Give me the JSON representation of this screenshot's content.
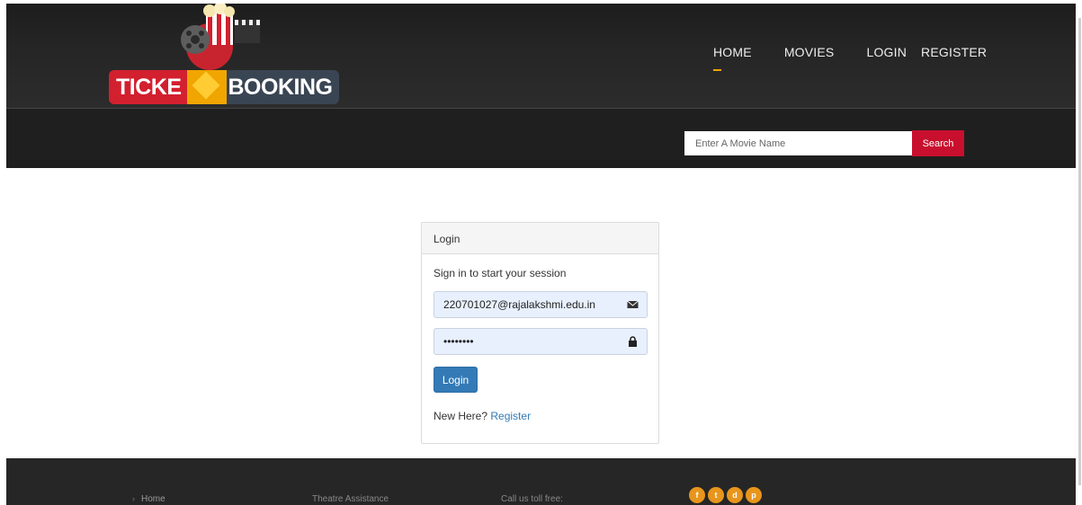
{
  "brand": {
    "logo_left": "TICKE",
    "logo_right": "BOOKING"
  },
  "nav": {
    "items": [
      {
        "label": "HOME"
      },
      {
        "label": "MOVIES"
      },
      {
        "label": "LOGIN"
      },
      {
        "label": "REGISTER"
      }
    ]
  },
  "search": {
    "placeholder": "Enter A Movie Name",
    "button_label": "Search"
  },
  "login_panel": {
    "heading": "Login",
    "subtitle": "Sign in to start your session",
    "email_value": "220701027@rajalakshmi.edu.in",
    "password_value": "••••••••",
    "button_label": "Login",
    "new_here": "New Here?",
    "register_link": "Register",
    "email_icon": "envelope-icon",
    "password_icon": "lock-icon"
  },
  "footer": {
    "home_link": "Home",
    "col2": "Theatre Assistance",
    "col3": "Call us toll free:",
    "social": [
      {
        "icon": "facebook-icon",
        "glyph": "f"
      },
      {
        "icon": "twitter-icon",
        "glyph": "t"
      },
      {
        "icon": "dribbble-icon",
        "glyph": "d"
      },
      {
        "icon": "pinterest-icon",
        "glyph": "p"
      }
    ]
  },
  "colors": {
    "accent": "#f0a500",
    "search_button": "#c8102e",
    "primary_button": "#337ab7",
    "social": "#e8951c"
  }
}
